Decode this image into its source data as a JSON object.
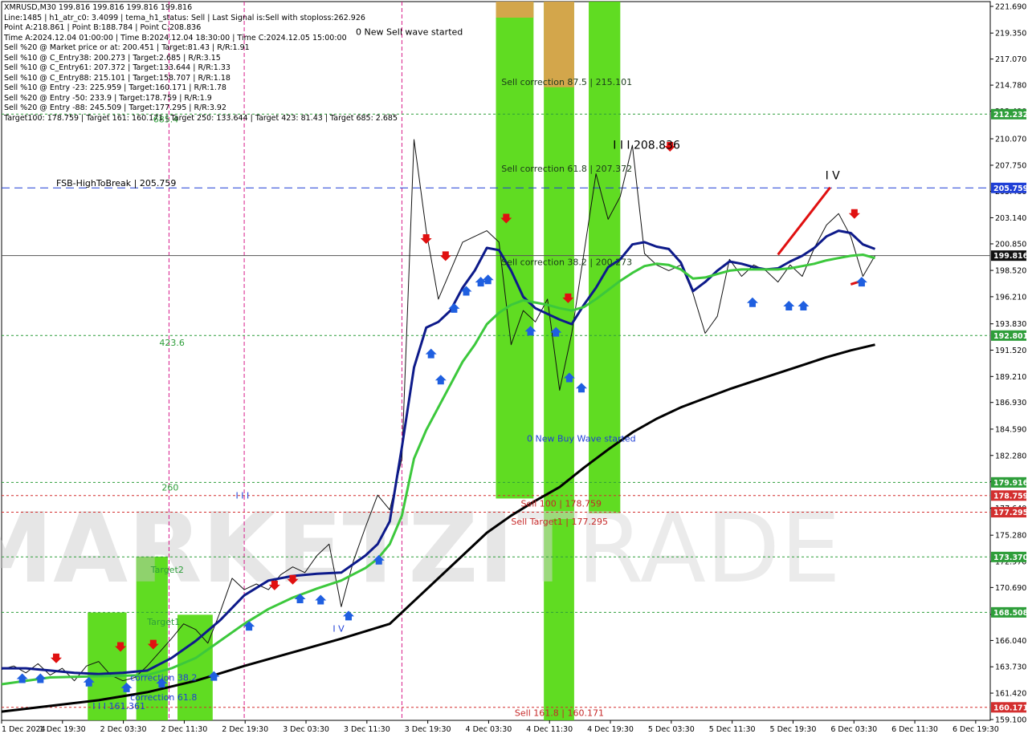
{
  "info": {
    "lines": [
      "XMRUSD,M30  199.816 199.816 199.816 199.816",
      "Line:1485  |  h1_atr_c0: 3.4099  |  tema_h1_status: Sell  |  Last Signal is:Sell with stoploss:262.926",
      "Point A:218.861  |  Point B:188.784  |  Point C:208.836",
      "Time A:2024.12.04 01:00:00  |  Time B:2024.12.04 18:30:00  |  Time C:2024.12.05 15:00:00",
      "Sell %20 @ Market price or at: 200.451  |  Target:81.43  |  R/R:1.91",
      "Sell %10 @ C_Entry38: 200.273  |  Target:2.685  |  R/R:3.15",
      "Sell %10 @ C_Entry61: 207.372  |  Target:133.644  |  R/R:1.33",
      "Sell %10 @ C_Entry88: 215.101  |  Target:158.707  |  R/R:1.18",
      "Sell %10 @ Entry -23: 225.959  |  Target:160.171  |  R/R:1.78",
      "Sell %20 @ Entry -50: 233.9  |  Target:178.759  |  R/R:1.9",
      "Sell %20 @ Entry -88: 245.509  |  Target:177.295  |  R/R:3.92",
      "Target100: 178.759  |  Target 161: 160.171  |  Target 250: 133.644  |  Target 423: 81.43  |  Target 685: 2.685"
    ]
  },
  "chart_data": {
    "type": "line",
    "title": "XMRUSD,M30",
    "ylim": [
      159.03,
      222.11
    ],
    "y_ticks": [
      221.69,
      219.35,
      217.07,
      214.78,
      212.49,
      210.07,
      207.75,
      205.46,
      203.14,
      200.85,
      198.52,
      196.21,
      193.83,
      191.52,
      189.21,
      186.93,
      184.59,
      182.28,
      179.97,
      177.64,
      175.28,
      172.97,
      170.69,
      168.33,
      166.04,
      163.73,
      161.42,
      159.1
    ],
    "x_ticks": [
      "1 Dec 2024",
      "1 Dec 19:30",
      "2 Dec 03:30",
      "2 Dec 11:30",
      "2 Dec 19:30",
      "3 Dec 03:30",
      "3 Dec 11:30",
      "3 Dec 19:30",
      "4 Dec 03:30",
      "4 Dec 11:30",
      "4 Dec 19:30",
      "5 Dec 03:30",
      "5 Dec 11:30",
      "5 Dec 19:30",
      "6 Dec 03:30",
      "6 Dec 11:30",
      "6 Dec 19:30"
    ],
    "current_price": 199.816,
    "price_tags": [
      {
        "value": 212.232,
        "color": "#2e9e3a"
      },
      {
        "value": 205.759,
        "color": "#1f3fd6"
      },
      {
        "value": 199.816,
        "color": "#111111"
      },
      {
        "value": 192.801,
        "color": "#2e9e3a"
      },
      {
        "value": 179.916,
        "color": "#2e9e3a"
      },
      {
        "value": 178.759,
        "color": "#d32f2f"
      },
      {
        "value": 177.295,
        "color": "#d32f2f"
      },
      {
        "value": 173.37,
        "color": "#2e9e3a"
      },
      {
        "value": 168.508,
        "color": "#2e9e3a"
      },
      {
        "value": 160.171,
        "color": "#d32f2f"
      }
    ],
    "levels": [
      {
        "value": 212.232,
        "color": "#2e9e3a",
        "style": "dotted"
      },
      {
        "value": 205.759,
        "color": "#1f3fd6",
        "style": "dashed"
      },
      {
        "value": 199.816,
        "color": "#555555",
        "style": "solid"
      },
      {
        "value": 192.801,
        "color": "#2e9e3a",
        "style": "dotted"
      },
      {
        "value": 179.916,
        "color": "#2e9e3a",
        "style": "dotted"
      },
      {
        "value": 178.759,
        "color": "#d32f2f",
        "style": "dotted"
      },
      {
        "value": 177.295,
        "color": "#d32f2f",
        "style": "dotted"
      },
      {
        "value": 173.37,
        "color": "#2e9e3a",
        "style": "dotted"
      },
      {
        "value": 168.508,
        "color": "#2e9e3a",
        "style": "dotted"
      },
      {
        "value": 160.171,
        "color": "#d32f2f",
        "style": "dotted"
      }
    ],
    "annotations": [
      {
        "text": "0 New Sell wave started",
        "x": 29.2,
        "y": 219.2,
        "color": "#000000"
      },
      {
        "text": "Sell correction 87.5 | 215.101",
        "x": 41.2,
        "y": 214.8,
        "color": "#1b3a1b"
      },
      {
        "text": "Sell correction 61.8 | 207.372",
        "x": 41.2,
        "y": 207.2,
        "color": "#1b3a1b"
      },
      {
        "text": "Sell correction 38.2 | 200.273",
        "x": 41.2,
        "y": 199.0,
        "color": "#1b3a1b"
      },
      {
        "text": "I I I 208.836",
        "x": 50.4,
        "y": 209.2,
        "color": "#000000"
      },
      {
        "text": "I V",
        "x": 67.9,
        "y": 206.5,
        "color": "#000000"
      },
      {
        "text": "FSB-HighToBreak  |  205.759",
        "x": 4.5,
        "y": 205.9,
        "color": "#000000"
      },
      {
        "text": "423.6",
        "x": 13.0,
        "y": 191.9,
        "color": "#2e9e3a"
      },
      {
        "text": "0 New Buy Wave started",
        "x": 43.3,
        "y": 183.5,
        "color": "#1f3fd6"
      },
      {
        "text": "260",
        "x": 13.2,
        "y": 179.2,
        "color": "#2e9e3a"
      },
      {
        "text": "I I I",
        "x": 19.3,
        "y": 178.5,
        "color": "#1f3fd6"
      },
      {
        "text": "Sell 100  |  178.759",
        "x": 42.8,
        "y": 177.8,
        "color": "#c62828"
      },
      {
        "text": "Sell Target1  |  177.295",
        "x": 42.0,
        "y": 176.2,
        "color": "#c62828"
      },
      {
        "text": "Target2",
        "x": 12.3,
        "y": 172.0,
        "color": "#2e9e3a"
      },
      {
        "text": "Target1",
        "x": 12.0,
        "y": 167.4,
        "color": "#2e9e3a"
      },
      {
        "text": "I V",
        "x": 27.3,
        "y": 166.8,
        "color": "#1f3fd6"
      },
      {
        "text": "correction 38.2",
        "x": 10.6,
        "y": 162.5,
        "color": "#1f3fd6"
      },
      {
        "text": "correction 61.8",
        "x": 10.6,
        "y": 160.8,
        "color": "#1f3fd6"
      },
      {
        "text": "I I I 161.361",
        "x": 7.5,
        "y": 160.0,
        "color": "#1f3fd6"
      },
      {
        "text": "685.4",
        "x": 12.5,
        "y": 211.5,
        "color": "#2e9e3a"
      },
      {
        "text": "Sell 161.8  |  160.171",
        "x": 42.3,
        "y": 159.4,
        "color": "#c62828"
      }
    ],
    "zones": [
      {
        "x0": 40.75,
        "x1": 43.85,
        "y0": 178.5,
        "y1": 222.11,
        "color": "#4fd80a"
      },
      {
        "x0": 40.75,
        "x1": 43.85,
        "y0": 220.7,
        "y1": 222.11,
        "color": "#e0a050"
      },
      {
        "x0": 44.7,
        "x1": 47.2,
        "y0": 159.03,
        "y1": 222.11,
        "color": "#4fd80a"
      },
      {
        "x0": 44.7,
        "x1": 47.2,
        "y0": 214.6,
        "y1": 222.11,
        "color": "#e0a050"
      },
      {
        "x0": 48.4,
        "x1": 51.0,
        "y0": 177.2,
        "y1": 222.11,
        "color": "#4fd80a"
      },
      {
        "x0": 7.1,
        "x1": 10.3,
        "y0": 159.03,
        "y1": 168.5,
        "color": "#4fd80a"
      },
      {
        "x0": 11.1,
        "x1": 13.7,
        "y0": 159.03,
        "y1": 173.4,
        "color": "#4fd80a"
      },
      {
        "x0": 14.5,
        "x1": 17.4,
        "y0": 159.03,
        "y1": 168.3,
        "color": "#4fd80a"
      }
    ],
    "vlines": [
      {
        "x": 13.8,
        "color": "#d81b8a"
      },
      {
        "x": 20.0,
        "color": "#d81b8a"
      },
      {
        "x": 33.0,
        "color": "#d81b8a"
      }
    ],
    "series": [
      {
        "name": "price",
        "color": "#111111",
        "x": [
          0,
          1,
          2,
          3,
          4,
          5,
          6,
          7,
          8,
          9,
          10,
          11,
          12,
          13,
          14,
          15,
          16,
          17,
          18,
          19,
          20,
          21,
          22,
          23,
          24,
          25,
          26,
          27,
          28,
          29,
          30,
          31,
          32,
          33,
          34,
          35,
          36,
          37,
          38,
          39,
          40,
          41,
          42,
          43,
          44,
          45,
          46,
          47,
          48,
          49,
          50,
          51,
          52,
          53,
          54,
          55,
          56,
          57,
          58,
          59,
          60,
          61,
          62,
          63,
          64,
          65,
          66,
          67,
          68,
          69,
          70,
          71,
          72
        ],
        "values": [
          163.5,
          163.8,
          163.2,
          164.0,
          163.0,
          163.6,
          162.5,
          163.8,
          164.2,
          163.0,
          162.5,
          162.8,
          163.8,
          165.0,
          166.2,
          167.5,
          167.0,
          165.8,
          168.5,
          171.5,
          170.5,
          171.0,
          170.5,
          171.8,
          172.5,
          172.0,
          173.5,
          174.5,
          169.0,
          173.0,
          176.0,
          178.8,
          177.5,
          182.0,
          210.0,
          202.0,
          196.0,
          198.5,
          201.0,
          201.5,
          202.0,
          201.0,
          192.0,
          195.0,
          194.0,
          196.0,
          188.0,
          193.0,
          200.0,
          207.0,
          203.0,
          205.0,
          209.5,
          200.0,
          199.0,
          198.5,
          199.0,
          196.5,
          193.0,
          194.5,
          199.5,
          198.0,
          199.0,
          198.5,
          197.5,
          199.0,
          198.0,
          200.5,
          202.5,
          203.5,
          201.5,
          198.0,
          199.816
        ]
      },
      {
        "name": "tema-blue",
        "color": "#0d1a8a",
        "x": [
          0,
          2,
          4,
          6,
          8,
          10,
          12,
          14,
          16,
          18,
          20,
          22,
          24,
          26,
          28,
          30,
          31,
          32,
          33,
          34,
          35,
          36,
          37,
          38,
          39,
          40,
          41,
          42,
          43,
          44,
          45,
          46,
          47,
          48,
          49,
          50,
          51,
          52,
          53,
          54,
          55,
          56,
          57,
          58,
          59,
          60,
          61,
          62,
          63,
          64,
          65,
          66,
          67,
          68,
          69,
          70,
          71,
          72
        ],
        "values": [
          163.6,
          163.6,
          163.4,
          163.2,
          163.1,
          163.2,
          163.4,
          164.5,
          166.0,
          167.8,
          170.0,
          171.3,
          171.7,
          171.9,
          172.0,
          173.5,
          174.5,
          176.5,
          183.0,
          190.0,
          193.5,
          194.0,
          195.0,
          197.0,
          198.5,
          200.5,
          200.3,
          198.5,
          196.2,
          195.2,
          194.7,
          194.2,
          193.8,
          195.5,
          197.0,
          198.8,
          199.5,
          200.8,
          201.0,
          200.6,
          200.4,
          199.2,
          196.7,
          197.5,
          198.5,
          199.3,
          199.1,
          198.8,
          198.6,
          198.7,
          199.3,
          199.8,
          200.5,
          201.5,
          202.0,
          201.8,
          200.8,
          200.4
        ]
      },
      {
        "name": "ma-green",
        "color": "#3cc83c",
        "x": [
          0,
          4,
          8,
          12,
          14,
          16,
          18,
          20,
          22,
          24,
          26,
          28,
          30,
          31,
          32,
          33,
          34,
          35,
          36,
          37,
          38,
          39,
          40,
          41,
          42,
          43,
          44,
          45,
          46,
          47,
          48,
          49,
          50,
          51,
          52,
          53,
          54,
          55,
          56,
          57,
          58,
          59,
          60,
          61,
          62,
          63,
          64,
          65,
          66,
          67,
          68,
          69,
          70,
          71,
          72
        ],
        "values": [
          162.2,
          162.8,
          162.9,
          163.0,
          163.6,
          164.5,
          166.0,
          167.5,
          168.8,
          169.8,
          170.6,
          171.3,
          172.4,
          173.2,
          174.5,
          177.0,
          182.0,
          184.5,
          186.5,
          188.5,
          190.5,
          192.0,
          193.8,
          194.8,
          195.5,
          195.9,
          195.7,
          195.5,
          195.2,
          195.0,
          195.3,
          196.0,
          196.8,
          197.6,
          198.3,
          198.9,
          199.1,
          199.0,
          198.6,
          197.8,
          197.9,
          198.2,
          198.5,
          198.6,
          198.6,
          198.6,
          198.6,
          198.7,
          198.9,
          199.1,
          199.4,
          199.6,
          199.8,
          199.9,
          199.6
        ]
      },
      {
        "name": "ma-black",
        "color": "#000000",
        "x": [
          0,
          4,
          8,
          12,
          16,
          20,
          24,
          28,
          32,
          34,
          36,
          38,
          40,
          42,
          44,
          46,
          48,
          50,
          52,
          54,
          56,
          58,
          60,
          62,
          64,
          66,
          68,
          70,
          72
        ],
        "values": [
          159.8,
          160.3,
          160.8,
          161.5,
          162.5,
          163.8,
          165.0,
          166.2,
          167.5,
          169.5,
          171.5,
          173.5,
          175.5,
          177.0,
          178.3,
          179.5,
          181.2,
          182.8,
          184.3,
          185.5,
          186.5,
          187.3,
          188.1,
          188.8,
          189.5,
          190.2,
          190.9,
          191.5,
          192.0
        ]
      }
    ],
    "sell_arrows": [
      [
        4.5,
        164.4
      ],
      [
        9.8,
        165.4
      ],
      [
        12.5,
        165.6
      ],
      [
        22.5,
        170.8
      ],
      [
        24.0,
        171.3
      ],
      [
        35.0,
        201.2
      ],
      [
        36.6,
        199.7
      ],
      [
        41.6,
        203.0
      ],
      [
        46.7,
        196.0
      ],
      [
        55.1,
        209.3
      ],
      [
        70.3,
        203.4
      ]
    ],
    "buy_arrows": [
      [
        1.7,
        162.8
      ],
      [
        3.2,
        162.8
      ],
      [
        7.2,
        162.5
      ],
      [
        10.3,
        162.0
      ],
      [
        13.2,
        162.4
      ],
      [
        17.5,
        163.0
      ],
      [
        20.4,
        167.4
      ],
      [
        24.6,
        169.8
      ],
      [
        26.3,
        169.7
      ],
      [
        28.6,
        168.3
      ],
      [
        31.1,
        173.2
      ],
      [
        35.4,
        191.3
      ],
      [
        36.2,
        189.0
      ],
      [
        37.3,
        195.3
      ],
      [
        38.3,
        196.8
      ],
      [
        39.5,
        197.6
      ],
      [
        40.1,
        197.8
      ],
      [
        43.6,
        193.3
      ],
      [
        45.7,
        193.2
      ],
      [
        46.8,
        189.2
      ],
      [
        47.8,
        188.3
      ],
      [
        61.9,
        195.8
      ],
      [
        64.9,
        195.5
      ],
      [
        66.1,
        195.5
      ],
      [
        70.9,
        197.6
      ]
    ],
    "wave_line": [
      [
        64.0,
        199.9
      ],
      [
        68.3,
        205.8
      ]
    ],
    "sell_line": [
      [
        70.0,
        197.3
      ],
      [
        70.9,
        197.6
      ]
    ]
  }
}
